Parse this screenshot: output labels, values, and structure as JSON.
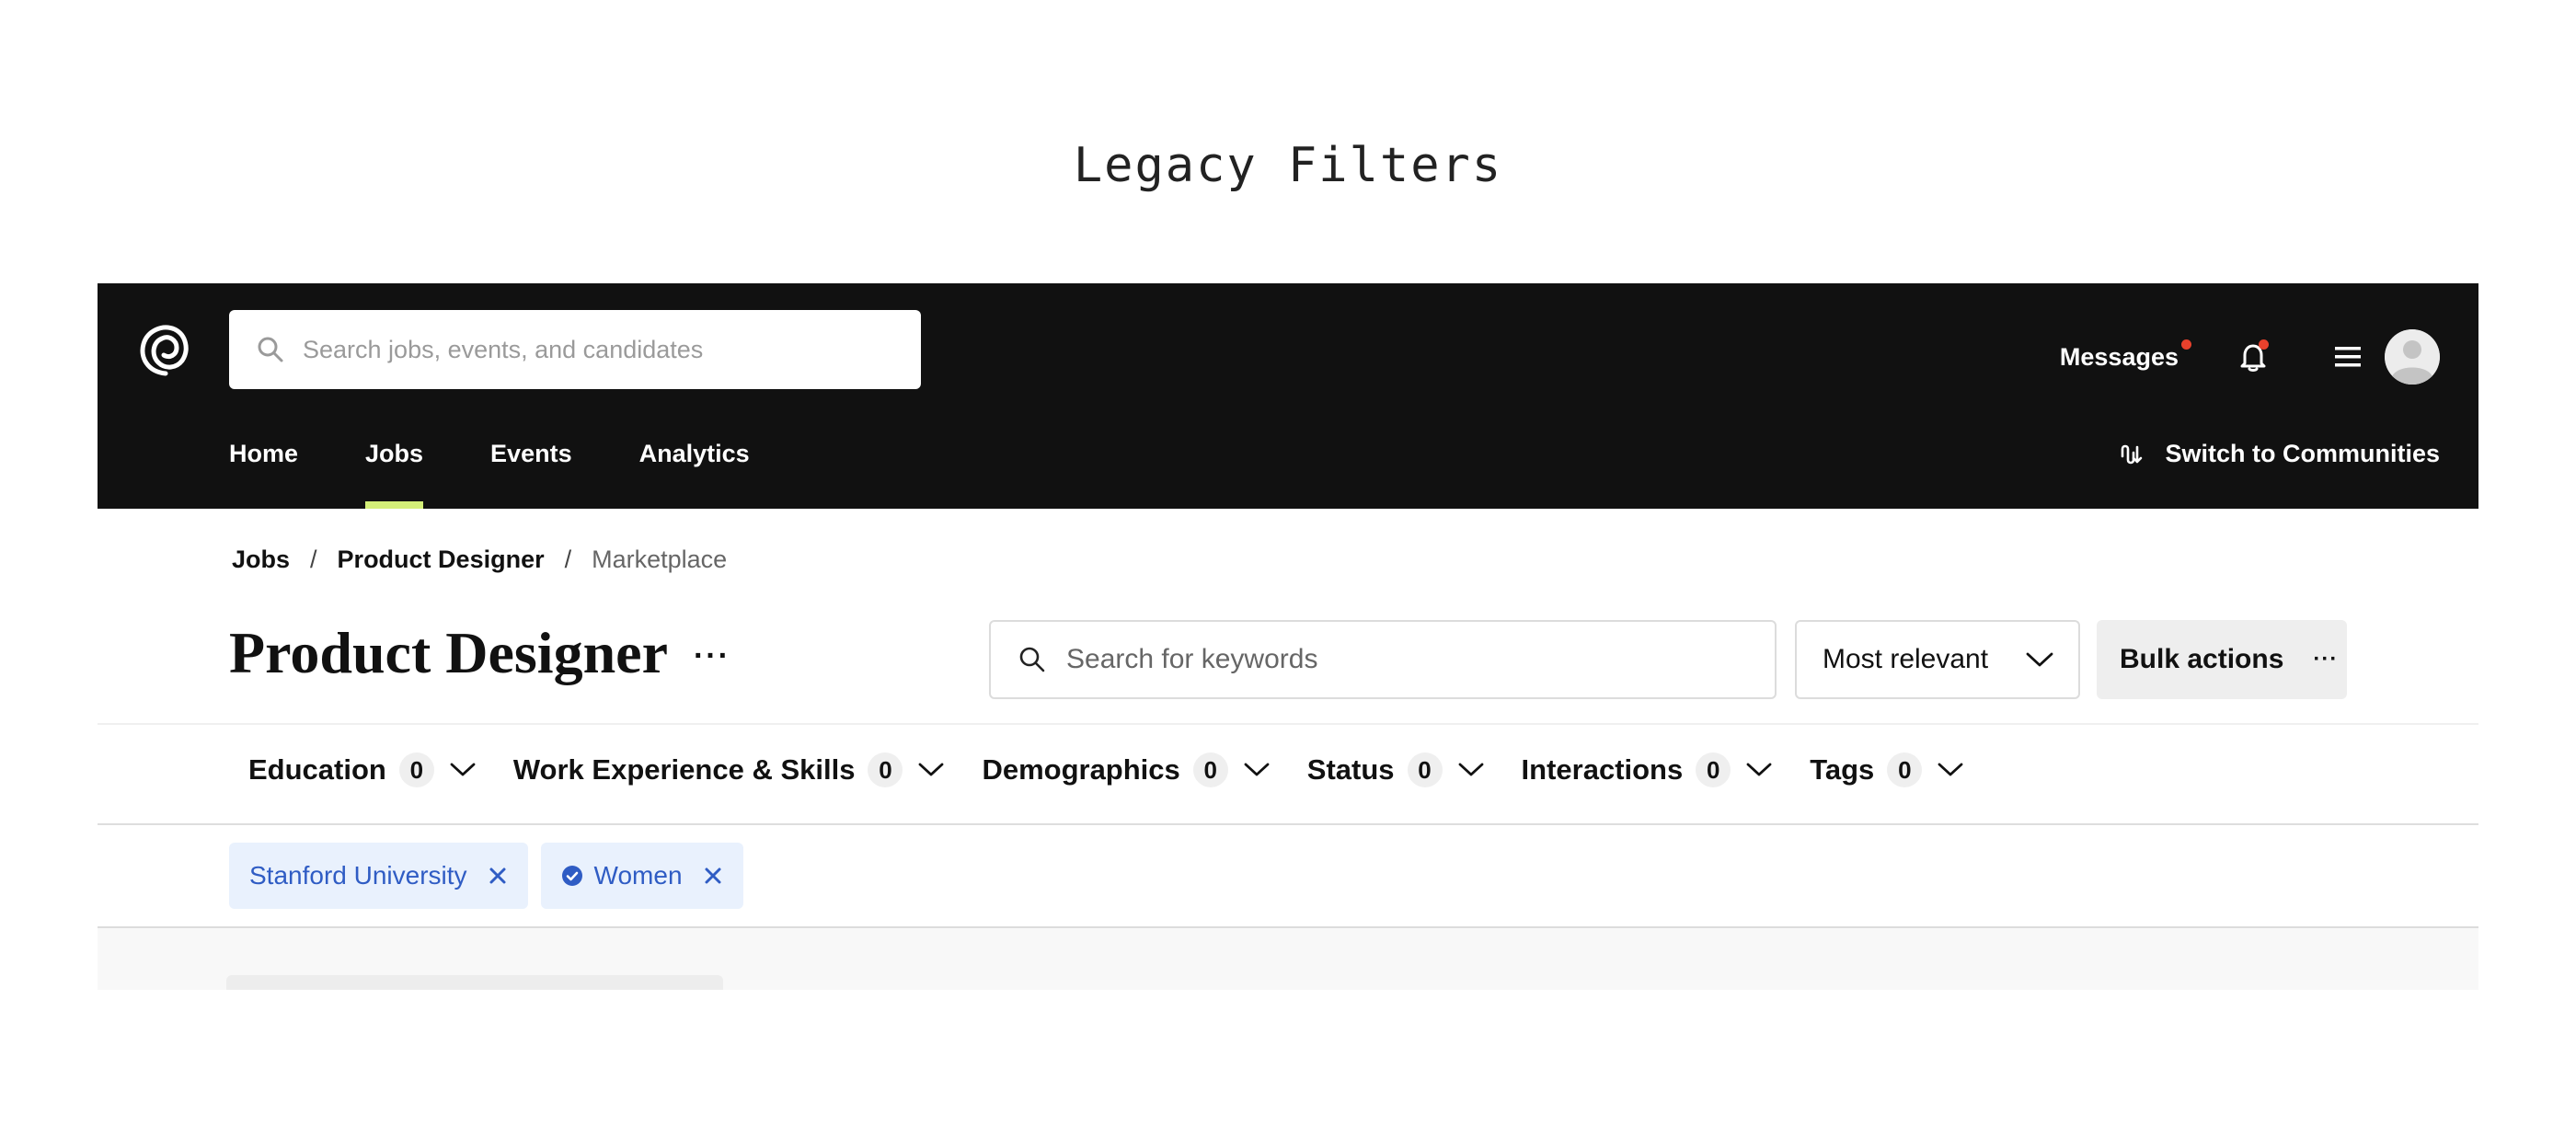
{
  "caption": "Legacy Filters",
  "header": {
    "search_placeholder": "Search jobs, events, and candidates",
    "messages_label": "Messages",
    "nav_tabs": [
      {
        "label": "Home",
        "active": false
      },
      {
        "label": "Jobs",
        "active": true
      },
      {
        "label": "Events",
        "active": false
      },
      {
        "label": "Analytics",
        "active": false
      }
    ],
    "switch_label": "Switch to Communities"
  },
  "breadcrumb": {
    "items": [
      "Jobs",
      "Product Designer",
      "Marketplace"
    ],
    "separator": "/"
  },
  "page": {
    "title": "Product Designer",
    "more": "···",
    "keyword_placeholder": "Search for keywords",
    "sort_value": "Most relevant",
    "bulk_label": "Bulk actions",
    "bulk_more": "···"
  },
  "filters": [
    {
      "label": "Education",
      "count": "0"
    },
    {
      "label": "Work Experience & Skills",
      "count": "0"
    },
    {
      "label": "Demographics",
      "count": "0"
    },
    {
      "label": "Status",
      "count": "0"
    },
    {
      "label": "Interactions",
      "count": "0"
    },
    {
      "label": "Tags",
      "count": "0"
    }
  ],
  "chips": [
    {
      "label": "Stanford University",
      "verified": false
    },
    {
      "label": "Women",
      "verified": true
    }
  ],
  "colors": {
    "header_bg": "#111111",
    "active_tab_underline": "#d4ef78",
    "notification_dot": "#e8412c",
    "chip_bg": "#e9f1fd",
    "chip_text": "#2f5cc4"
  },
  "icons": [
    "logo-icon",
    "search-icon",
    "bell-icon",
    "hamburger-icon",
    "avatar",
    "switch-icon",
    "chevron-down-icon",
    "close-icon",
    "verified-check-icon"
  ]
}
